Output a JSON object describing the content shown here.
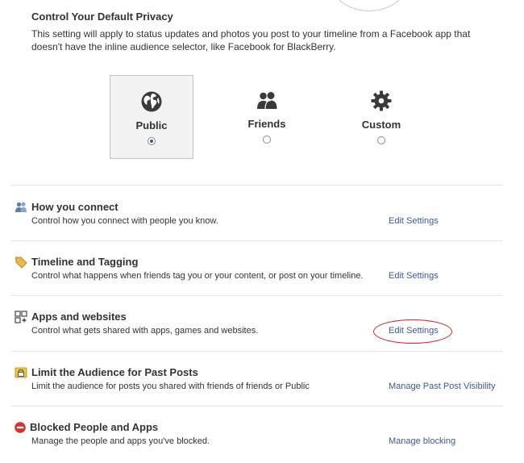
{
  "privacy": {
    "title": "Control Your Default Privacy",
    "description": "This setting will apply to status updates and photos you post to your timeline from a Facebook app that doesn't have the inline audience selector, like Facebook for BlackBerry.",
    "options": [
      {
        "label": "Public",
        "icon": "globe-icon",
        "selected": true
      },
      {
        "label": "Friends",
        "icon": "friends-icon",
        "selected": false
      },
      {
        "label": "Custom",
        "icon": "gear-icon",
        "selected": false
      }
    ]
  },
  "sections": [
    {
      "title": "How you connect",
      "description": "Control how you connect with people you know.",
      "link": "Edit Settings",
      "icon": "people-icon"
    },
    {
      "title": "Timeline and Tagging",
      "description": "Control what happens when friends tag you or your content, or post on your timeline.",
      "link": "Edit Settings",
      "icon": "tag-icon"
    },
    {
      "title": "Apps and websites",
      "description": "Control what gets shared with apps, games and websites.",
      "link": "Edit Settings",
      "icon": "apps-icon"
    },
    {
      "title": "Limit the Audience for Past Posts",
      "description": "Limit the audience for posts you shared with friends of friends or Public",
      "link": "Manage Past Post Visibility",
      "icon": "lock-icon"
    },
    {
      "title": "Blocked People and Apps",
      "description": "Manage the people and apps you've blocked.",
      "link": "Manage blocking",
      "icon": "blocked-icon"
    }
  ],
  "colors": {
    "link": "#3b5998",
    "highlight": "#d42020",
    "divider": "#e2e2e2"
  }
}
